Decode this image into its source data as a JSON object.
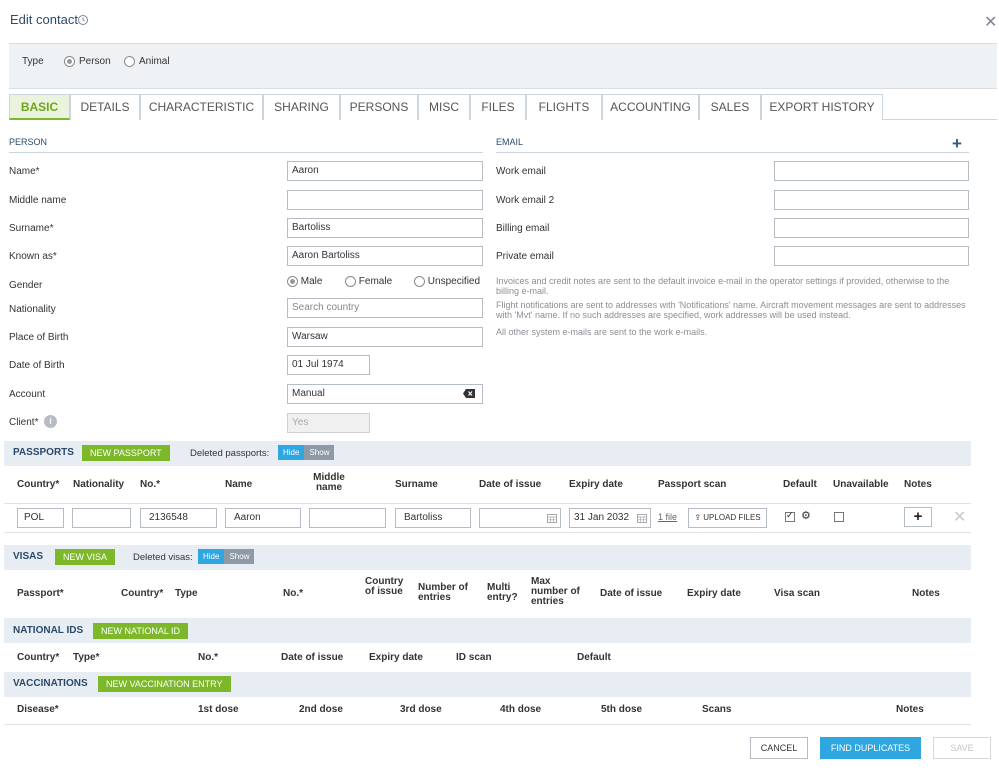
{
  "header": {
    "title": "Edit contact"
  },
  "type": {
    "label": "Type",
    "options": [
      {
        "label": "Person",
        "selected": true
      },
      {
        "label": "Animal",
        "selected": false
      }
    ]
  },
  "tabs": [
    "BASIC",
    "DETAILS",
    "CHARACTERISTIC",
    "SHARING",
    "PERSONS",
    "MISC",
    "FILES",
    "FLIGHTS",
    "ACCOUNTING",
    "SALES",
    "EXPORT HISTORY"
  ],
  "person": {
    "section": "PERSON",
    "name_label": "Name*",
    "name_value": "Aaron",
    "middle_label": "Middle name",
    "middle_value": "",
    "surname_label": "Surname*",
    "surname_value": "Bartoliss",
    "known_label": "Known as*",
    "known_value": "Aaron Bartoliss",
    "gender_label": "Gender",
    "gender_options": [
      "Male",
      "Female",
      "Unspecified"
    ],
    "gender_selected": "Male",
    "nationality_label": "Nationality",
    "nationality_placeholder": "Search country",
    "pob_label": "Place of Birth",
    "pob_value": "Warsaw",
    "dob_label": "Date of Birth",
    "dob_value": "01 Jul 1974",
    "account_label": "Account",
    "account_value": "Manual",
    "client_label": "Client*",
    "client_value": "Yes"
  },
  "email": {
    "section": "EMAIL",
    "work_label": "Work email",
    "work2_label": "Work email 2",
    "billing_label": "Billing email",
    "private_label": "Private email",
    "note1": "Invoices and credit notes are sent to the default invoice e-mail in the operator settings if provided, otherwise to the billing e-mail.",
    "note2": "Flight notifications are sent to addresses with 'Notifications' name. Aircraft movement messages are sent to addresses with 'Mvt' name. If no such addresses are specified, work addresses will be used instead.",
    "note3": "All other system e-mails are sent to the work e-mails."
  },
  "passports": {
    "title": "PASSPORTS",
    "new_button": "NEW PASSPORT",
    "deleted_label": "Deleted passports:",
    "hide": "Hide",
    "show": "Show",
    "columns": [
      "Country*",
      "Nationality",
      "No.*",
      "Name",
      "Middle name",
      "Surname",
      "Date of issue",
      "Expiry date",
      "Passport scan",
      "Default",
      "Unavailable",
      "Notes"
    ],
    "row": {
      "country": "POL",
      "nationality": "",
      "number": "2136548",
      "name": "Aaron",
      "middle": "",
      "surname": "Bartoliss",
      "issue": "",
      "expiry": "31 Jan 2032",
      "files": "1 file",
      "upload": "UPLOAD FILES",
      "default": true,
      "unavailable": false
    }
  },
  "visas": {
    "title": "VISAS",
    "new_button": "NEW VISA",
    "deleted_label": "Deleted visas:",
    "hide": "Hide",
    "show": "Show",
    "columns": [
      "Passport*",
      "Country*",
      "Type",
      "No.*",
      "Country of issue",
      "Number of entries",
      "Multi entry?",
      "Max number of entries",
      "Date of issue",
      "Expiry date",
      "Visa scan",
      "Notes"
    ]
  },
  "national_ids": {
    "title": "NATIONAL IDS",
    "new_button": "NEW NATIONAL ID",
    "columns": [
      "Country*",
      "Type*",
      "No.*",
      "Date of issue",
      "Expiry date",
      "ID scan",
      "Default"
    ]
  },
  "vaccinations": {
    "title": "VACCINATIONS",
    "new_button": "NEW VACCINATION ENTRY",
    "columns": [
      "Disease*",
      "1st dose",
      "2nd dose",
      "3rd dose",
      "4th dose",
      "5th dose",
      "Scans",
      "Notes"
    ]
  },
  "footer": {
    "cancel": "CANCEL",
    "find_duplicates": "FIND DUPLICATES",
    "save": "SAVE"
  }
}
